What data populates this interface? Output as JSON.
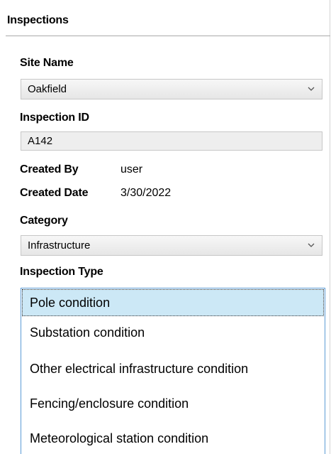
{
  "panel": {
    "title": "Inspections"
  },
  "site": {
    "label": "Site Name",
    "value": "Oakfield",
    "dropdown_icon": "chevron-down-icon"
  },
  "inspection_id": {
    "label": "Inspection ID",
    "value": "A142"
  },
  "created_by": {
    "label": "Created By",
    "value": "user"
  },
  "created_date": {
    "label": "Created Date",
    "value": "3/30/2022"
  },
  "category": {
    "label": "Category",
    "value": "Infrastructure",
    "dropdown_icon": "chevron-down-icon"
  },
  "inspection_type": {
    "label": "Inspection Type",
    "items": [
      {
        "label": "Pole condition",
        "selected": true
      },
      {
        "label": "Substation condition",
        "selected": false
      },
      {
        "label": "Other electrical infrastructure condition",
        "selected": false
      },
      {
        "label": "Fencing/enclosure condition",
        "selected": false
      },
      {
        "label": "Meteorological station condition",
        "selected": false
      }
    ]
  },
  "colors": {
    "selection_bg": "#cce8f6",
    "listbox_border": "#5b9bd5",
    "field_bg": "#eeeeee"
  }
}
